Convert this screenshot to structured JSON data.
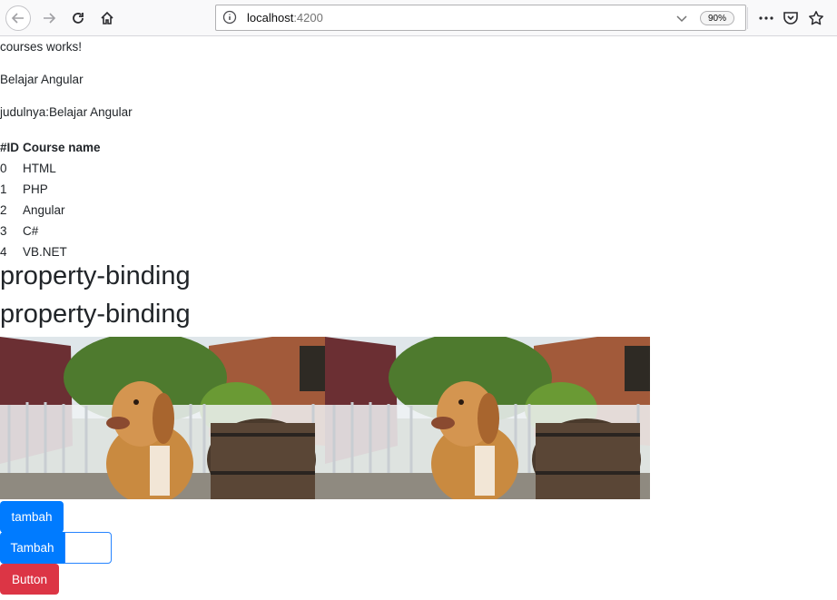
{
  "browser": {
    "url_host": "localhost",
    "url_port": ":4200",
    "zoom": "90%"
  },
  "page": {
    "line1": "courses works!",
    "line2": "Belajar Angular",
    "line3": "judulnya:Belajar Angular",
    "table": {
      "headers": [
        "#ID",
        "Course name"
      ],
      "rows": [
        [
          "0",
          "HTML"
        ],
        [
          "1",
          "PHP"
        ],
        [
          "2",
          "Angular"
        ],
        [
          "3",
          "C#"
        ],
        [
          "4",
          "VB.NET"
        ]
      ]
    },
    "heading1": "property-binding",
    "heading2": "property-binding",
    "button_tambah": "tambah",
    "button_Tambah": "Tambah",
    "input_value": "",
    "button_red": "Button"
  },
  "colors": {
    "primary": "#007bff",
    "danger": "#dc3545"
  },
  "icons": [
    "back-icon",
    "forward-icon",
    "reload-icon",
    "home-icon",
    "info-icon",
    "chevron-down-icon",
    "more-icon",
    "pocket-icon",
    "star-icon"
  ]
}
